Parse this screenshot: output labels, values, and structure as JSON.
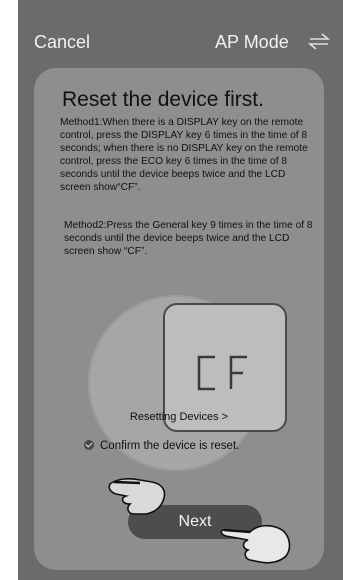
{
  "header": {
    "cancel_label": "Cancel",
    "mode_label": "AP Mode",
    "switch_icon": "swap-arrows-icon"
  },
  "card": {
    "title": "Reset the device first.",
    "method1": "Method1:When there is a DISPLAY key on the remote control, press the DISPLAY key 6 times in the time of 8 seconds; when there is no DISPLAY key on the remote control, press the ECO key 6 times in the time of 8 seconds until the device beeps twice and the LCD screen show“CF”.",
    "method2": "Method2:Press the General key 9 times in the time of 8 seconds until the device beeps twice and the LCD screen show “CF”.",
    "display_text": "CF",
    "resetting_link": "Resetting Devices >",
    "confirm_label": "Confirm the device is reset.",
    "confirm_checked": true,
    "next_label": "Next"
  },
  "colors": {
    "background": "#6b6b6b",
    "card": "#8e8e8e",
    "button": "#4d4d4d",
    "text_light": "#f2f2f2"
  }
}
